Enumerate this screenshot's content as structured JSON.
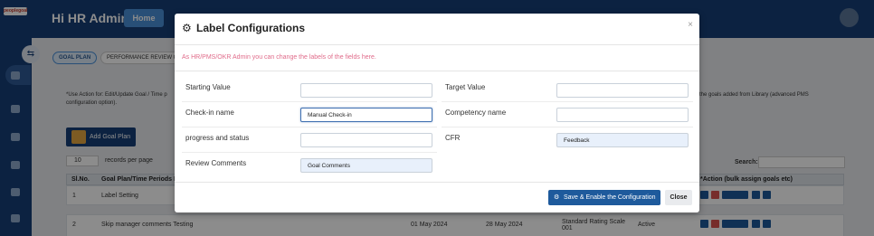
{
  "app": {
    "logo_text": "peoplegoal",
    "greeting": "Hi HR Admin",
    "home_label": "Home"
  },
  "tabs": [
    {
      "label": "GOAL PLAN"
    },
    {
      "label": "PERFORMANCE REVIEW CY"
    }
  ],
  "page": {
    "note": "*Use Action for: Edit/Update Goal / Time p configuration option).",
    "note_right": "the goals added from Library (advanced PMS",
    "add_goal_label": "Add Goal Plan",
    "entries_value": "10",
    "entries_suffix": "records per page",
    "search_label": "Search:"
  },
  "table": {
    "headers": [
      "Sl.No.",
      "Goal Plan/Time Periods N",
      "*Action (bulk assign goals etc)"
    ],
    "rows": [
      {
        "sl": "1",
        "name": "Label Setting",
        "start": "",
        "end": "",
        "scale": "",
        "status": ""
      },
      {
        "sl": "2",
        "name": "Skip manager comments Testing",
        "start": "01 May 2024",
        "end": "28 May 2024",
        "scale": "Standard Rating Scale 001",
        "status": "Active"
      }
    ]
  },
  "modal": {
    "title": "Label Configurations",
    "hint": "As HR/PMS/OKR Admin you can change the labels of the fields here.",
    "fields": [
      {
        "label": "Starting Value",
        "value": ""
      },
      {
        "label": "Target Value",
        "value": ""
      },
      {
        "label": "Check-in name",
        "value": "Manual Check-in"
      },
      {
        "label": "Competency name",
        "value": ""
      },
      {
        "label": "progress and status",
        "value": ""
      },
      {
        "label": "CFR",
        "value": "Feedback"
      },
      {
        "label": "Review Comments",
        "value": "Goal Comments"
      }
    ],
    "save_label": "Save & Enable the Configuration",
    "close_label": "Close",
    "close_x": "×"
  },
  "icons": {
    "gear": "gear-icon",
    "save": "gear-icon",
    "toggle": "sidebar-toggle-icon"
  },
  "colors": {
    "sidebar": "#173f77",
    "primary_button": "#1e5a9c",
    "hint_text": "#e06b8a",
    "focused_border": "#3f6fb0"
  }
}
